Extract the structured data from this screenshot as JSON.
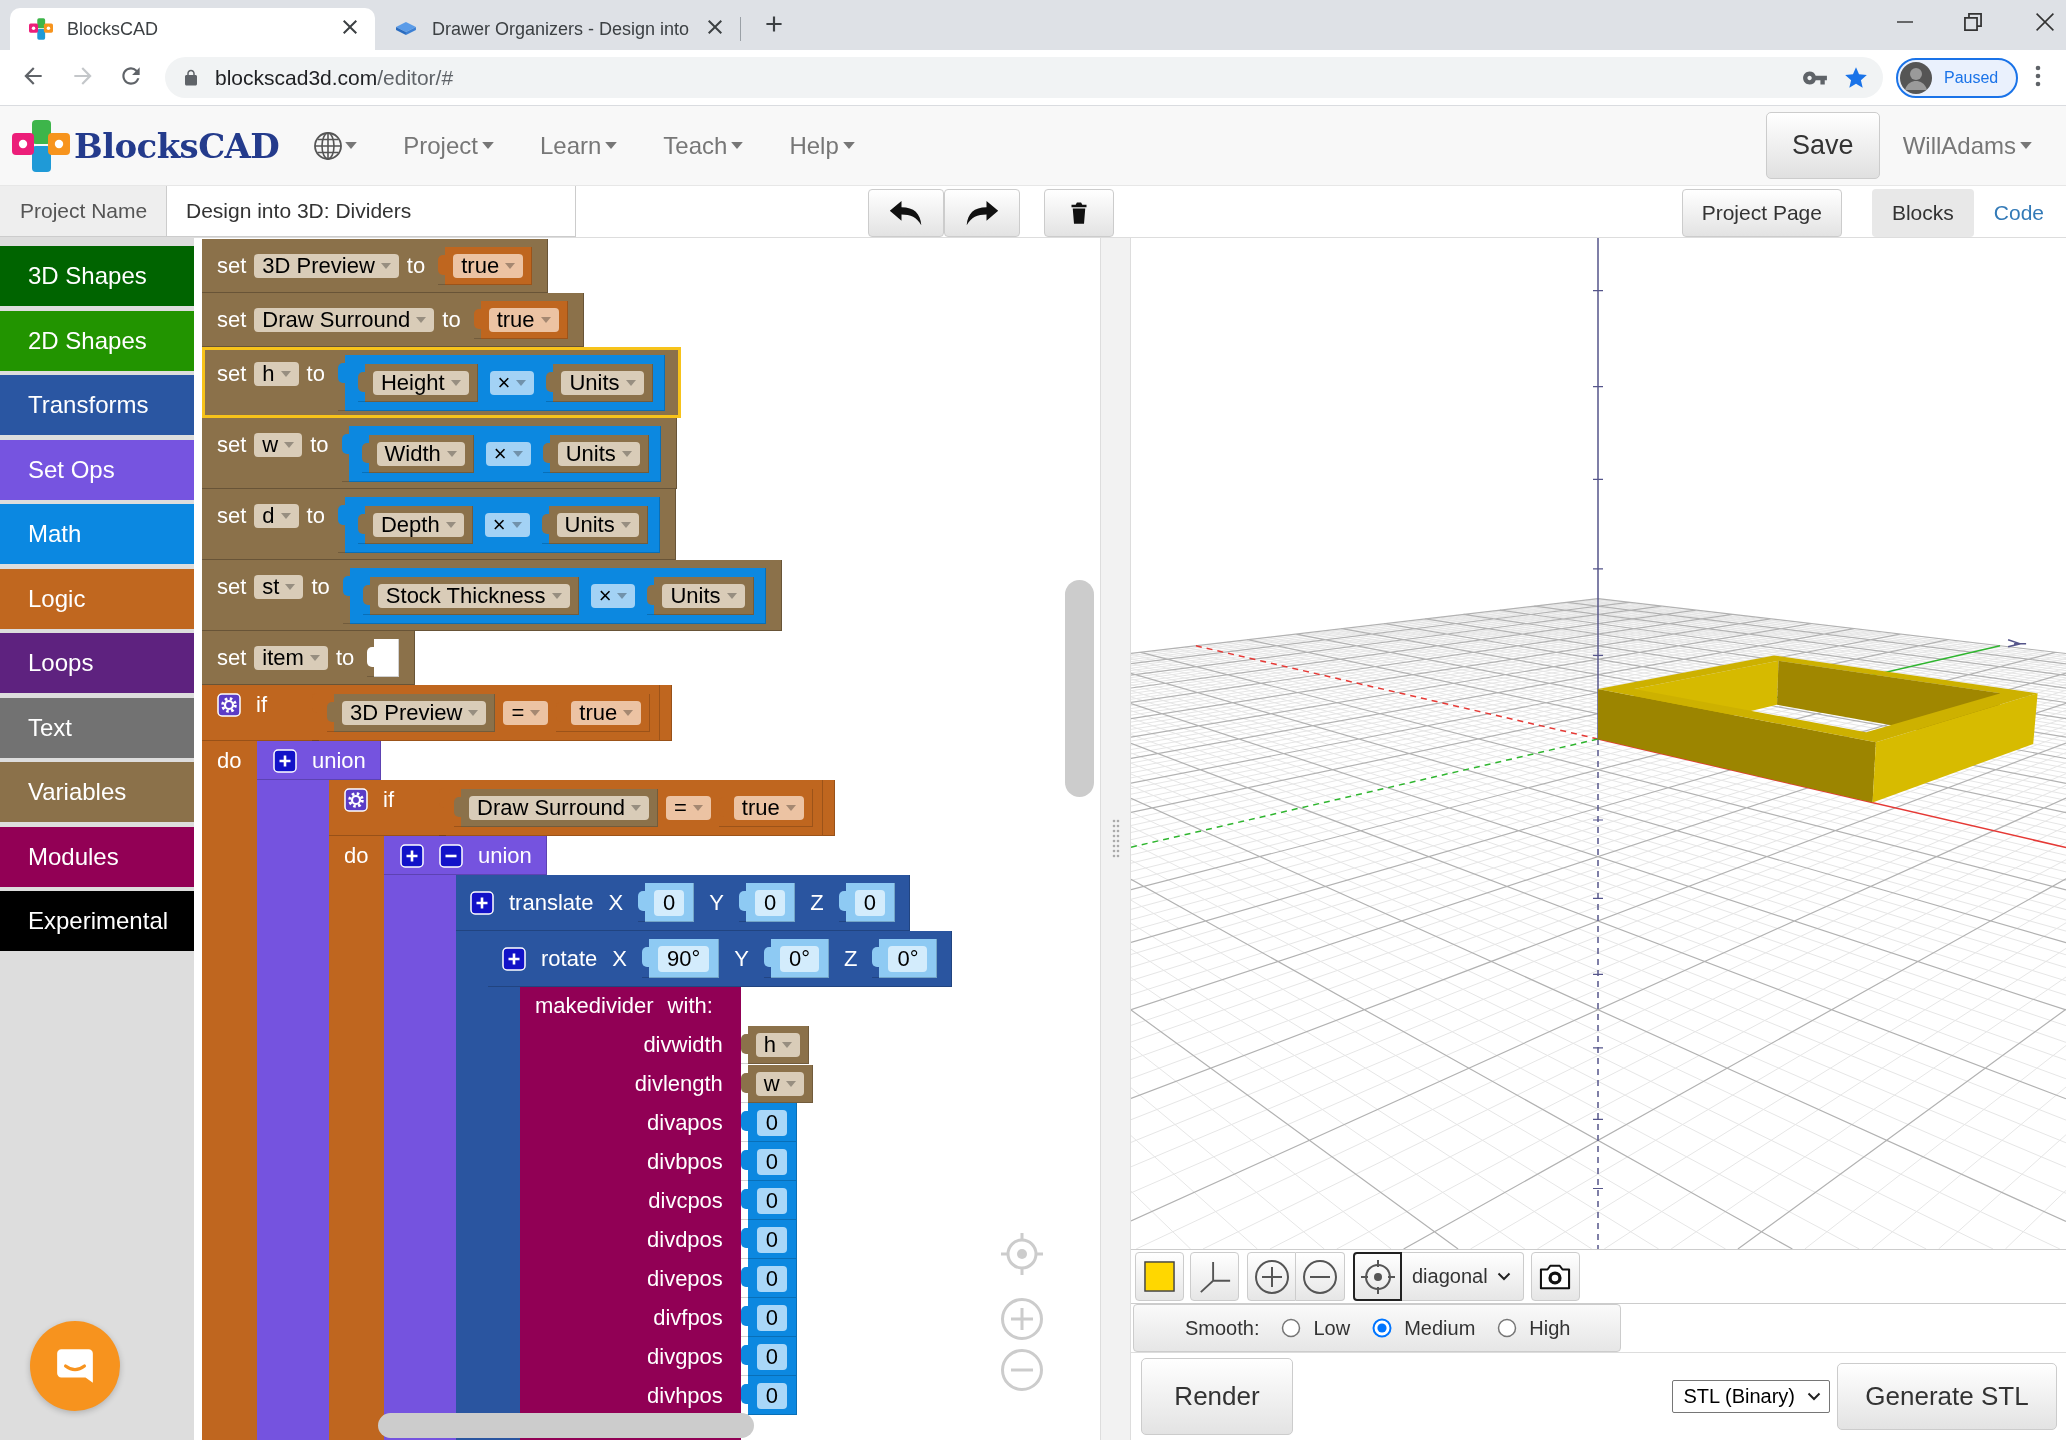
{
  "browser": {
    "tabs": [
      {
        "title": "BlocksCAD",
        "selected": true
      },
      {
        "title": "Drawer Organizers - Design into",
        "selected": false
      }
    ],
    "address": {
      "host": "blockscad3d.com",
      "path": "/editor/#"
    },
    "profile": {
      "label": "Paused"
    }
  },
  "navbar": {
    "logo": "BlocksCAD",
    "menus": [
      "Project",
      "Learn",
      "Teach",
      "Help"
    ],
    "save": "Save",
    "user": "WillAdams"
  },
  "project_bar": {
    "label": "Project Name",
    "value": "Design into 3D: Dividers",
    "project_page": "Project Page",
    "tabs": [
      {
        "label": "Blocks",
        "selected": true
      },
      {
        "label": "Code",
        "selected": false
      }
    ]
  },
  "sidebar": {
    "categories": [
      {
        "label": "3D Shapes",
        "color": "#006400"
      },
      {
        "label": "2D Shapes",
        "color": "#229400"
      },
      {
        "label": "Transforms",
        "color": "#2a56a2"
      },
      {
        "label": "Set Ops",
        "color": "#7654e0"
      },
      {
        "label": "Math",
        "color": "#0b88e1"
      },
      {
        "label": "Logic",
        "color": "#c0671f"
      },
      {
        "label": "Loops",
        "color": "#5e227f"
      },
      {
        "label": "Text",
        "color": "#727272"
      },
      {
        "label": "Variables",
        "color": "#8b714a"
      },
      {
        "label": "Modules",
        "color": "#920055"
      },
      {
        "label": "Experimental",
        "color": "#000000"
      }
    ]
  },
  "workspace": {
    "blocks": [
      {
        "kind": "set",
        "selected": false,
        "parts": [
          {
            "kind": "label",
            "text": "set"
          },
          {
            "kind": "dropdown",
            "text": "3D Preview"
          },
          {
            "kind": "label",
            "text": "to"
          },
          {
            "kind": "input",
            "block": {
              "kind": "boolean",
              "parts": [
                {
                  "kind": "dropdown",
                  "text": "true"
                }
              ]
            }
          }
        ]
      },
      {
        "kind": "set",
        "selected": false,
        "parts": [
          {
            "kind": "label",
            "text": "set"
          },
          {
            "kind": "dropdown",
            "text": "Draw Surround"
          },
          {
            "kind": "label",
            "text": "to"
          },
          {
            "kind": "input",
            "block": {
              "kind": "boolean",
              "parts": [
                {
                  "kind": "dropdown",
                  "text": "true"
                }
              ]
            }
          }
        ]
      },
      {
        "kind": "set",
        "selected": true,
        "parts": [
          {
            "kind": "label",
            "text": "set"
          },
          {
            "kind": "dropdown",
            "text": "h"
          },
          {
            "kind": "label",
            "text": "to"
          },
          {
            "kind": "input",
            "block": {
              "kind": "arithmetic",
              "parts": [
                {
                  "kind": "input",
                  "block": {
                    "kind": "variable",
                    "parts": [
                      {
                        "kind": "dropdown",
                        "text": "Height"
                      }
                    ]
                  }
                },
                {
                  "kind": "dropdown",
                  "text": "×"
                },
                {
                  "kind": "input",
                  "block": {
                    "kind": "variable",
                    "parts": [
                      {
                        "kind": "dropdown",
                        "text": "Units"
                      }
                    ]
                  }
                }
              ]
            }
          }
        ]
      },
      {
        "kind": "set",
        "selected": false,
        "parts": [
          {
            "kind": "label",
            "text": "set"
          },
          {
            "kind": "dropdown",
            "text": "w"
          },
          {
            "kind": "label",
            "text": "to"
          },
          {
            "kind": "input",
            "block": {
              "kind": "arithmetic",
              "parts": [
                {
                  "kind": "input",
                  "block": {
                    "kind": "variable",
                    "parts": [
                      {
                        "kind": "dropdown",
                        "text": "Width"
                      }
                    ]
                  }
                },
                {
                  "kind": "dropdown",
                  "text": "×"
                },
                {
                  "kind": "input",
                  "block": {
                    "kind": "variable",
                    "parts": [
                      {
                        "kind": "dropdown",
                        "text": "Units"
                      }
                    ]
                  }
                }
              ]
            }
          }
        ]
      },
      {
        "kind": "set",
        "selected": false,
        "parts": [
          {
            "kind": "label",
            "text": "set"
          },
          {
            "kind": "dropdown",
            "text": "d"
          },
          {
            "kind": "label",
            "text": "to"
          },
          {
            "kind": "input",
            "block": {
              "kind": "arithmetic",
              "parts": [
                {
                  "kind": "input",
                  "block": {
                    "kind": "variable",
                    "parts": [
                      {
                        "kind": "dropdown",
                        "text": "Depth"
                      }
                    ]
                  }
                },
                {
                  "kind": "dropdown",
                  "text": "×"
                },
                {
                  "kind": "input",
                  "block": {
                    "kind": "variable",
                    "parts": [
                      {
                        "kind": "dropdown",
                        "text": "Units"
                      }
                    ]
                  }
                }
              ]
            }
          }
        ]
      },
      {
        "kind": "set",
        "selected": false,
        "parts": [
          {
            "kind": "label",
            "text": "set"
          },
          {
            "kind": "dropdown",
            "text": "st"
          },
          {
            "kind": "label",
            "text": "to"
          },
          {
            "kind": "input",
            "block": {
              "kind": "arithmetic",
              "parts": [
                {
                  "kind": "input",
                  "block": {
                    "kind": "variable",
                    "parts": [
                      {
                        "kind": "dropdown",
                        "text": "Stock Thickness"
                      }
                    ]
                  }
                },
                {
                  "kind": "dropdown",
                  "text": "×"
                },
                {
                  "kind": "input",
                  "block": {
                    "kind": "variable",
                    "parts": [
                      {
                        "kind": "dropdown",
                        "text": "Units"
                      }
                    ]
                  }
                }
              ]
            }
          }
        ]
      },
      {
        "kind": "set",
        "selected": false,
        "parts": [
          {
            "kind": "label",
            "text": "set"
          },
          {
            "kind": "dropdown",
            "text": "item"
          },
          {
            "kind": "label",
            "text": "to"
          },
          {
            "kind": "input"
          }
        ]
      },
      {
        "kind": "if",
        "selected": false,
        "parts": [
          {
            "kind": "mutator"
          },
          {
            "kind": "label",
            "text": "if"
          },
          {
            "kind": "input",
            "block": {
              "kind": "compare",
              "parts": [
                {
                  "kind": "input",
                  "block": {
                    "kind": "variable",
                    "parts": [
                      {
                        "kind": "dropdown",
                        "text": "3D Preview"
                      }
                    ]
                  }
                },
                {
                  "kind": "dropdown",
                  "text": "="
                },
                {
                  "kind": "input",
                  "block": {
                    "kind": "boolean",
                    "parts": [
                      {
                        "kind": "dropdown",
                        "text": "true"
                      }
                    ]
                  }
                }
              ]
            }
          }
        ],
        "body_label": "do",
        "body": [
          {
            "kind": "setop",
            "selected": false,
            "parts": [
              {
                "kind": "add"
              },
              {
                "kind": "label",
                "text": "union"
              }
            ],
            "body": [
              {
                "kind": "if",
                "selected": false,
                "parts": [
                  {
                    "kind": "mutator"
                  },
                  {
                    "kind": "label",
                    "text": "if"
                  },
                  {
                    "kind": "input",
                    "block": {
                      "kind": "compare",
                      "parts": [
                        {
                          "kind": "input",
                          "block": {
                            "kind": "variable",
                            "parts": [
                              {
                                "kind": "dropdown",
                                "text": "Draw Surround"
                              }
                            ]
                          }
                        },
                        {
                          "kind": "dropdown",
                          "text": "="
                        },
                        {
                          "kind": "input",
                          "block": {
                            "kind": "boolean",
                            "parts": [
                              {
                                "kind": "dropdown",
                                "text": "true"
                              }
                            ]
                          }
                        }
                      ]
                    }
                  }
                ],
                "body_label": "do",
                "body": [
                  {
                    "kind": "setop",
                    "selected": false,
                    "parts": [
                      {
                        "kind": "add"
                      },
                      {
                        "kind": "remove"
                      },
                      {
                        "kind": "label",
                        "text": "union"
                      }
                    ],
                    "body": [
                      {
                        "kind": "transform",
                        "selected": false,
                        "parts": [
                          {
                            "kind": "add"
                          },
                          {
                            "kind": "label",
                            "text": "translate"
                          },
                          {
                            "kind": "label",
                            "text": "X"
                          },
                          {
                            "kind": "input",
                            "block": {
                              "kind": "shadow",
                              "parts": [
                                {
                                  "kind": "number",
                                  "text": "0"
                                }
                              ]
                            }
                          },
                          {
                            "kind": "label",
                            "text": "Y"
                          },
                          {
                            "kind": "input",
                            "block": {
                              "kind": "shadow",
                              "parts": [
                                {
                                  "kind": "number",
                                  "text": "0"
                                }
                              ]
                            }
                          },
                          {
                            "kind": "label",
                            "text": "Z"
                          },
                          {
                            "kind": "input",
                            "block": {
                              "kind": "shadow",
                              "parts": [
                                {
                                  "kind": "number",
                                  "text": "0"
                                }
                              ]
                            }
                          }
                        ],
                        "body": [
                          {
                            "kind": "transform",
                            "selected": false,
                            "parts": [
                              {
                                "kind": "add"
                              },
                              {
                                "kind": "label",
                                "text": "rotate"
                              },
                              {
                                "kind": "label",
                                "text": "X"
                              },
                              {
                                "kind": "input",
                                "block": {
                                  "kind": "shadow",
                                  "parts": [
                                    {
                                      "kind": "number",
                                      "text": "90°"
                                    }
                                  ]
                                }
                              },
                              {
                                "kind": "label",
                                "text": "Y"
                              },
                              {
                                "kind": "input",
                                "block": {
                                  "kind": "shadow",
                                  "parts": [
                                    {
                                      "kind": "number",
                                      "text": "0°"
                                    }
                                  ]
                                }
                              },
                              {
                                "kind": "label",
                                "text": "Z"
                              },
                              {
                                "kind": "input",
                                "block": {
                                  "kind": "shadow",
                                  "parts": [
                                    {
                                      "kind": "number",
                                      "text": "0°"
                                    }
                                  ]
                                }
                              }
                            ],
                            "body": [
                              {
                                "kind": "module",
                                "selected": false,
                                "parts": [
                                  {
                                    "kind": "label",
                                    "text": "makedivider"
                                  },
                                  {
                                    "kind": "label",
                                    "text": "with:"
                                  }
                                ],
                                "params": [
                                  {
                                    "label": "divwidth",
                                    "block": {
                                      "kind": "variable",
                                      "parts": [
                                        {
                                          "kind": "dropdown",
                                          "text": "h"
                                        }
                                      ]
                                    }
                                  },
                                  {
                                    "label": "divlength",
                                    "block": {
                                      "kind": "variable",
                                      "parts": [
                                        {
                                          "kind": "dropdown",
                                          "text": "w"
                                        }
                                      ]
                                    }
                                  },
                                  {
                                    "label": "divapos",
                                    "block": {
                                      "kind": "number",
                                      "parts": [
                                        {
                                          "kind": "number",
                                          "text": "0"
                                        }
                                      ]
                                    }
                                  },
                                  {
                                    "label": "divbpos",
                                    "block": {
                                      "kind": "number",
                                      "parts": [
                                        {
                                          "kind": "number",
                                          "text": "0"
                                        }
                                      ]
                                    }
                                  },
                                  {
                                    "label": "divcpos",
                                    "block": {
                                      "kind": "number",
                                      "parts": [
                                        {
                                          "kind": "number",
                                          "text": "0"
                                        }
                                      ]
                                    }
                                  },
                                  {
                                    "label": "divdpos",
                                    "block": {
                                      "kind": "number",
                                      "parts": [
                                        {
                                          "kind": "number",
                                          "text": "0"
                                        }
                                      ]
                                    }
                                  },
                                  {
                                    "label": "divepos",
                                    "block": {
                                      "kind": "number",
                                      "parts": [
                                        {
                                          "kind": "number",
                                          "text": "0"
                                        }
                                      ]
                                    }
                                  },
                                  {
                                    "label": "divfpos",
                                    "block": {
                                      "kind": "number",
                                      "parts": [
                                        {
                                          "kind": "number",
                                          "text": "0"
                                        }
                                      ]
                                    }
                                  },
                                  {
                                    "label": "divgpos",
                                    "block": {
                                      "kind": "number",
                                      "parts": [
                                        {
                                          "kind": "number",
                                          "text": "0"
                                        }
                                      ]
                                    }
                                  },
                                  {
                                    "label": "divhpos",
                                    "block": {
                                      "kind": "number",
                                      "parts": [
                                        {
                                          "kind": "number",
                                          "text": "0"
                                        }
                                      ]
                                    }
                                  }
                                ]
                              }
                            ]
                          }
                        ]
                      }
                    ]
                  }
                ]
              }
            ]
          }
        ]
      }
    ]
  },
  "viewer": {
    "toolbar": {
      "target_active": true,
      "view": "diagonal"
    },
    "smooth": {
      "label": "Smooth:",
      "options": [
        {
          "label": "Low",
          "selected": false
        },
        {
          "label": "Medium",
          "selected": true
        },
        {
          "label": "High",
          "selected": false
        }
      ]
    },
    "render": "Render",
    "format": "STL (Binary)",
    "generate": "Generate STL"
  }
}
